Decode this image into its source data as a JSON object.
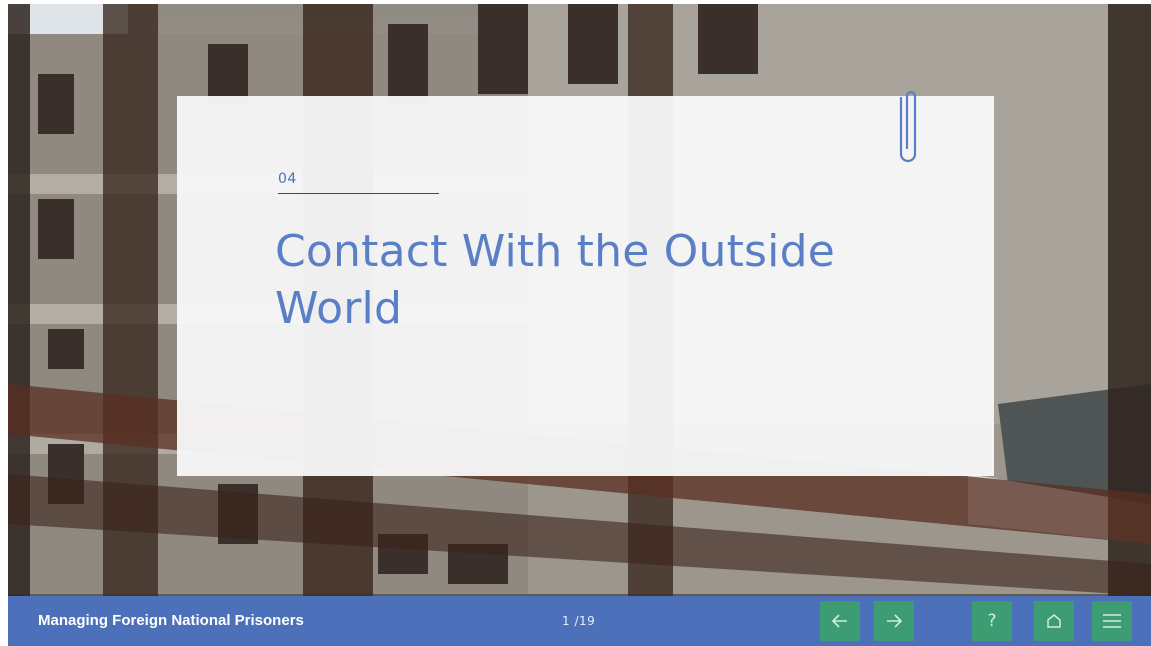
{
  "slide": {
    "section_number": "04",
    "title": "Contact With the Outside World"
  },
  "footer": {
    "course_title": "Managing Foreign National Prisoners",
    "page_indicator": "1 /19",
    "buttons": [
      {
        "name": "previous",
        "icon": "arrow-left-icon"
      },
      {
        "name": "next",
        "icon": "arrow-right-icon"
      },
      {
        "name": "help",
        "icon": "question-icon",
        "label": "?"
      },
      {
        "name": "home",
        "icon": "home-icon"
      },
      {
        "name": "menu",
        "icon": "hamburger-menu-icon"
      }
    ]
  },
  "colors": {
    "footer_bar": "#4c70b9",
    "nav_button": "#3e9c73",
    "title_text": "#5a7fc7",
    "card": "#f7f7f8"
  }
}
